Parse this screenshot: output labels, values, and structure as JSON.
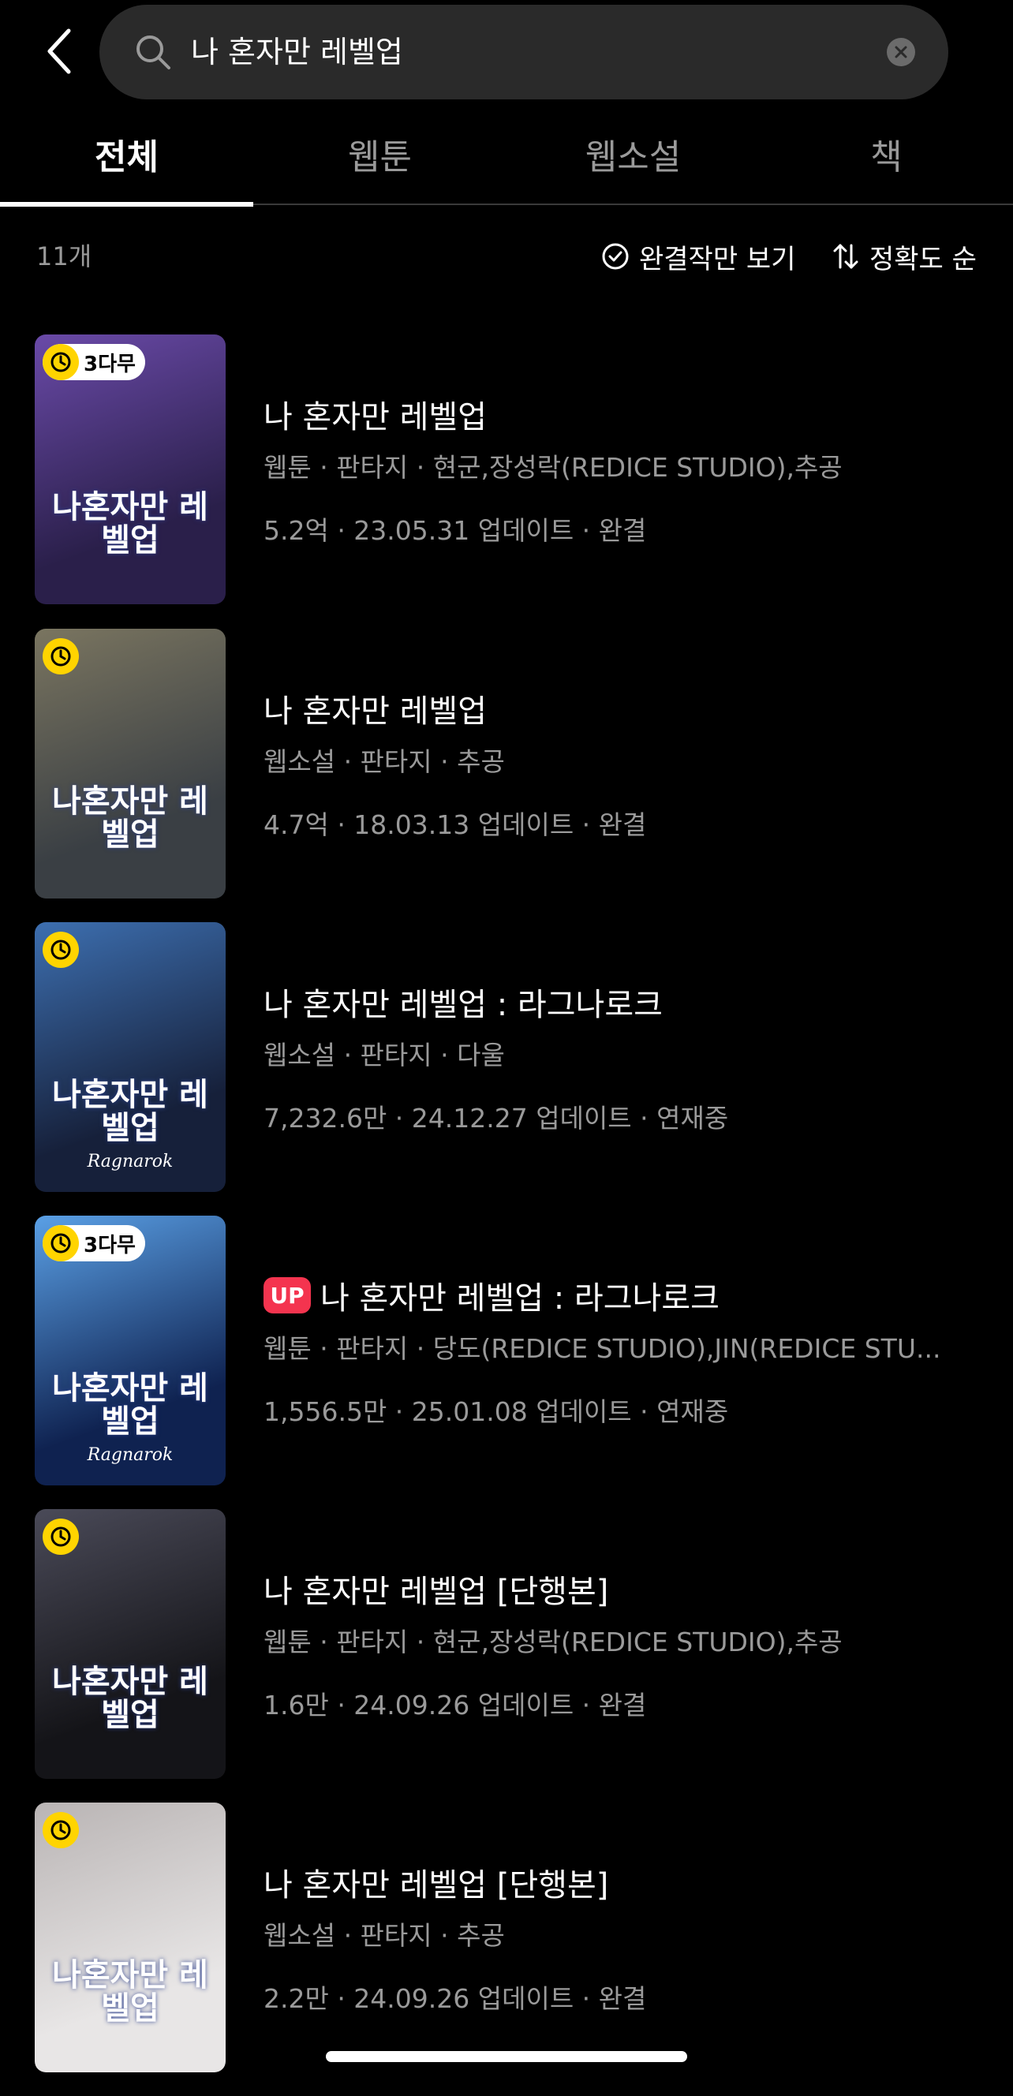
{
  "search": {
    "query": "나 혼자만 레벨업"
  },
  "tabs": [
    {
      "label": "전체",
      "active": true
    },
    {
      "label": "웹툰",
      "active": false
    },
    {
      "label": "웹소설",
      "active": false
    },
    {
      "label": "책",
      "active": false
    }
  ],
  "filters": {
    "count": "11개",
    "complete_only": "완결작만 보기",
    "sort": "정확도 순"
  },
  "items": [
    {
      "title": "나 혼자만 레벨업",
      "meta": "웹툰 · 판타지 · 현군,장성락(REDICE STUDIO),추공",
      "stats": "5.2억 · 23.05.31 업데이트 · 완결",
      "badge": "3다무",
      "thumb_title": "나혼자만 레벨업",
      "thumb_sub": "",
      "colors": [
        "#2a1f4a",
        "#6a4aa8"
      ]
    },
    {
      "title": "나 혼자만 레벨업",
      "meta": "웹소설 · 판타지 · 추공",
      "stats": "4.7억 · 18.03.13 업데이트 · 완결",
      "badge": "",
      "thumb_title": "나혼자만 레벨업",
      "thumb_sub": "",
      "colors": [
        "#3a3f44",
        "#7a7560"
      ]
    },
    {
      "title": "나 혼자만 레벨업 : 라그나로크",
      "meta": "웹소설 · 판타지 · 다울",
      "stats": "7,232.6만 · 24.12.27 업데이트 · 연재중",
      "badge": "",
      "thumb_title": "나혼자만 레벨업",
      "thumb_sub": "Ragnarok",
      "colors": [
        "#16203a",
        "#3d6fb0"
      ]
    },
    {
      "title": "나 혼자만 레벨업 : 라그나로크",
      "meta": "웹툰 · 판타지 · 당도(REDICE STUDIO),JIN(REDICE STU...",
      "stats": "1,556.5만 · 25.01.08 업데이트 · 연재중",
      "badge": "3다무",
      "up": "UP",
      "thumb_title": "나혼자만 레벨업",
      "thumb_sub": "Ragnarok",
      "colors": [
        "#0f2250",
        "#5aa0e6"
      ]
    },
    {
      "title": "나 혼자만 레벨업 [단행본]",
      "meta": "웹툰 · 판타지 · 현군,장성락(REDICE STUDIO),추공",
      "stats": "1.6만 · 24.09.26 업데이트 · 완결",
      "badge": "",
      "thumb_title": "나혼자만 레벨업",
      "thumb_sub": "",
      "colors": [
        "#141418",
        "#4a4a58"
      ]
    },
    {
      "title": "나 혼자만 레벨업 [단행본]",
      "meta": "웹소설 · 판타지 · 추공",
      "stats": "2.2만 · 24.09.26 업데이트 · 완결",
      "badge": "",
      "thumb_title": "나혼자만 레벨업",
      "thumb_sub": "",
      "colors": [
        "#e8e6e6",
        "#b9b4b4"
      ]
    }
  ],
  "icons": {
    "back": "chevron-left-icon",
    "search": "search-icon",
    "clear": "close-circle-icon",
    "check": "check-circle-icon",
    "sort": "sort-arrows-icon",
    "clock": "clock-icon"
  },
  "accent": {
    "badge_yellow": "#ffd400",
    "up_red": "#f4344f"
  }
}
